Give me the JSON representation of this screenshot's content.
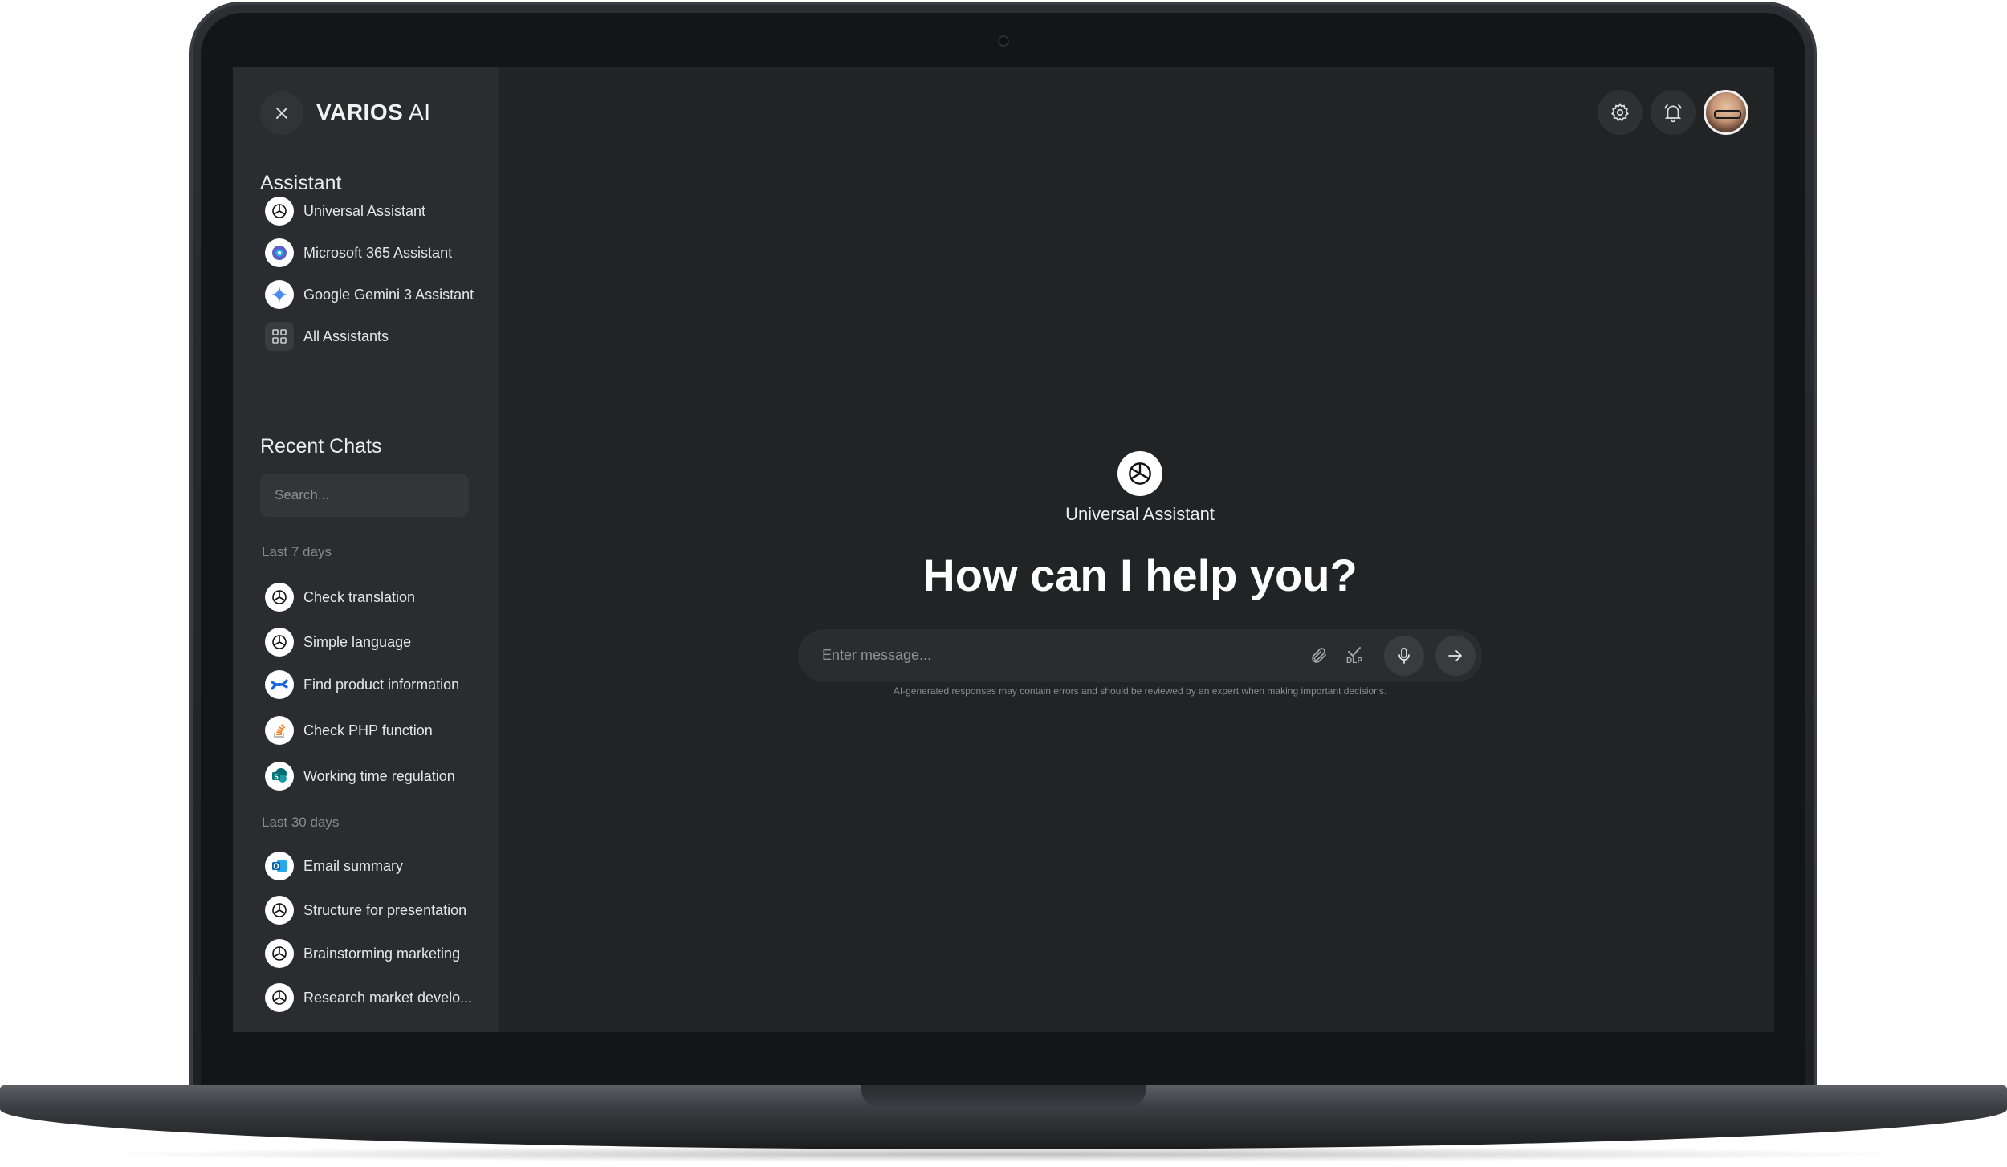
{
  "app": {
    "brand_bold": "VARIOS",
    "brand_light": " AI"
  },
  "sidebar": {
    "assistant_title": "Assistant",
    "assistants": [
      {
        "label": "Universal Assistant",
        "icon": "openai-icon"
      },
      {
        "label": "Microsoft 365 Assistant",
        "icon": "copilot-icon"
      },
      {
        "label": "Google Gemini 3 Assistant",
        "icon": "gemini-icon"
      },
      {
        "label": "All Assistants",
        "icon": "grid-icon"
      }
    ],
    "recent_title": "Recent Chats",
    "search_placeholder": "Search...",
    "groups": [
      {
        "label": "Last 7 days",
        "items": [
          {
            "label": "Check translation",
            "icon": "openai-icon"
          },
          {
            "label": "Simple language",
            "icon": "openai-icon"
          },
          {
            "label": "Find product information",
            "icon": "confluence-icon"
          },
          {
            "label": "Check PHP function",
            "icon": "stackoverflow-icon"
          },
          {
            "label": "Working time regulation",
            "icon": "sharepoint-icon"
          }
        ]
      },
      {
        "label": "Last 30 days",
        "items": [
          {
            "label": "Email summary",
            "icon": "outlook-icon"
          },
          {
            "label": "Structure for presentation",
            "icon": "openai-icon"
          },
          {
            "label": "Brainstorming marketing",
            "icon": "openai-icon"
          },
          {
            "label": "Research market develo...",
            "icon": "openai-icon"
          }
        ]
      }
    ]
  },
  "main": {
    "assistant_name": "Universal Assistant",
    "headline": "How can I help you?",
    "input_placeholder": "Enter message...",
    "dlp_label": "DLP",
    "disclaimer": "AI-generated responses may contain errors and should be reviewed by an expert when making important decisions."
  },
  "colors": {
    "background": "#222325",
    "sidebar": "#2b2c2f",
    "text": "#ffffff"
  }
}
